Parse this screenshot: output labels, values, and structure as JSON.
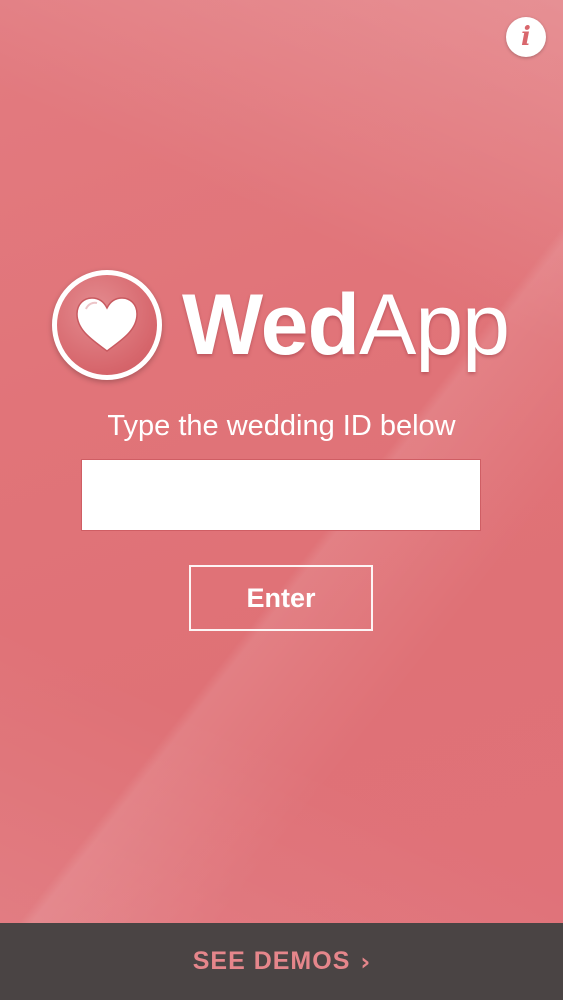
{
  "header": {
    "info_icon": "info-icon",
    "info_glyph": "i"
  },
  "logo": {
    "icon": "heart-icon",
    "text_bold": "Wed",
    "text_light": "App"
  },
  "form": {
    "prompt": "Type the wedding ID below",
    "wedding_id_value": "",
    "wedding_id_placeholder": "",
    "enter_label": "Enter"
  },
  "footer": {
    "demos_label": "SEE DEMOS",
    "chevron": "›",
    "chevron_icon": "chevron-right-icon"
  },
  "colors": {
    "background": "#e07479",
    "accent": "#d9676d",
    "footer_bg": "#4a4444",
    "footer_text": "#e5868b"
  }
}
